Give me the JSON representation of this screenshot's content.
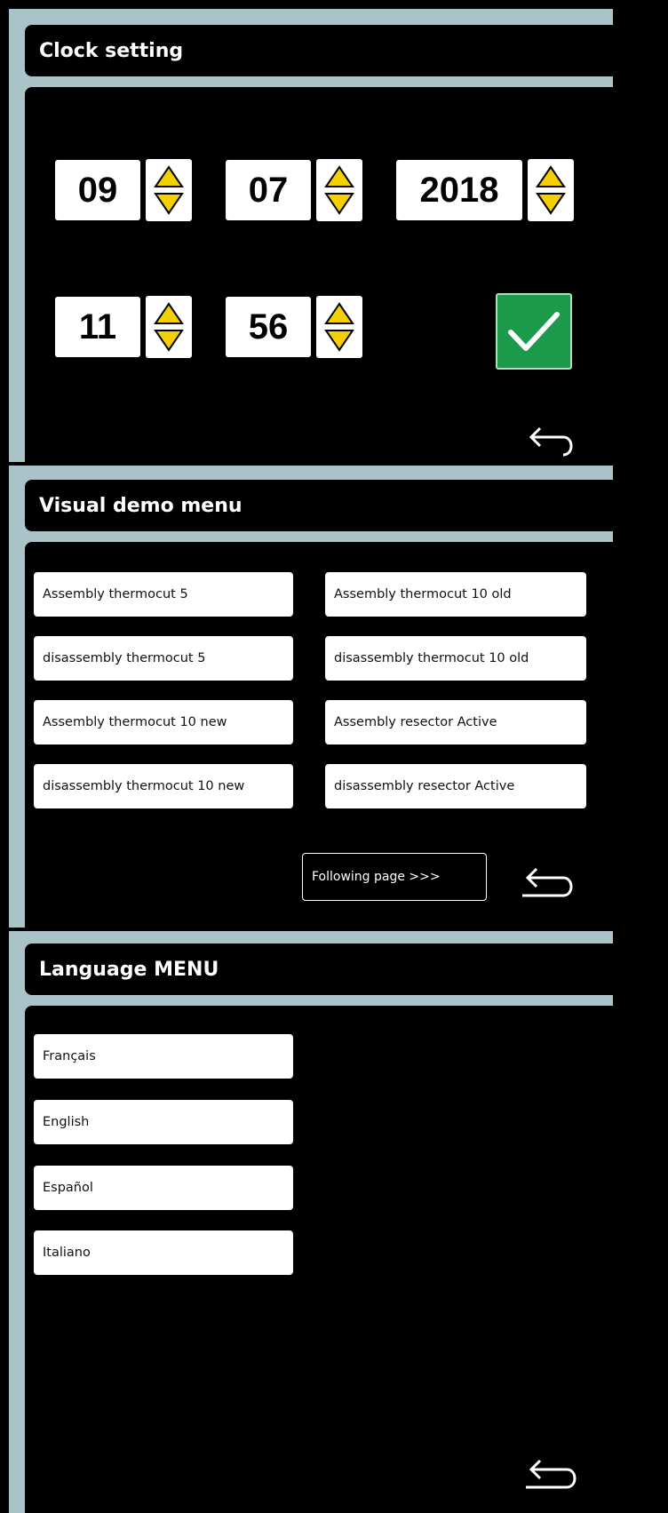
{
  "clock": {
    "title": "Clock setting",
    "day": "09",
    "month": "07",
    "year": "2018",
    "hour": "11",
    "minute": "56",
    "confirm_icon": "checkmark-icon",
    "back_icon": "return-arrow-icon"
  },
  "demo": {
    "title": "Visual demo menu",
    "left_items": [
      "Assembly thermocut 5",
      "disassembly thermocut 5",
      "Assembly thermocut 10 new",
      "disassembly thermocut 10 new"
    ],
    "right_items": [
      "Assembly thermocut 10 old",
      "disassembly thermocut 10 old",
      "Assembly resector  Active",
      "disassembly resector Active"
    ],
    "following_label": "Following page >>>",
    "back_icon": "return-arrow-icon"
  },
  "language": {
    "title": "Language MENU",
    "items": [
      "Français",
      "English",
      "Español",
      "Italiano"
    ],
    "back_icon": "return-arrow-icon"
  },
  "colors": {
    "frame": "#a9c3c8",
    "arrow_yellow": "#f5d000",
    "confirm_green": "#1a9a4a"
  }
}
